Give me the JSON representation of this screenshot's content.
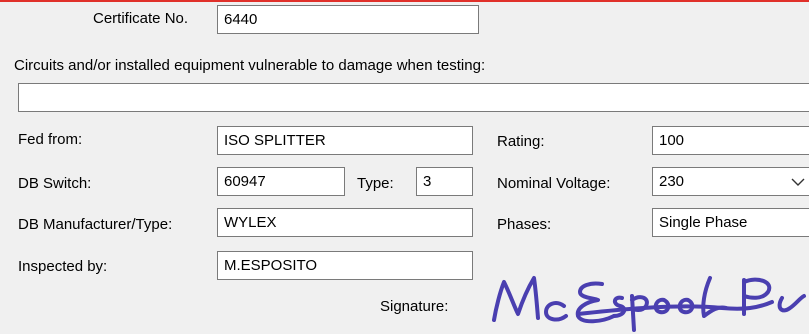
{
  "certificate": {
    "label": "Certificate No.",
    "value": "6440"
  },
  "vulnerable": {
    "label": "Circuits and/or installed equipment vulnerable to damage when testing:",
    "value": ""
  },
  "fed_from": {
    "label": "Fed from:",
    "value": "ISO SPLITTER"
  },
  "db_switch": {
    "label": "DB Switch:",
    "value": "60947"
  },
  "type": {
    "label": "Type:",
    "value": "3"
  },
  "db_manufacturer": {
    "label": "DB Manufacturer/Type:",
    "value": "WYLEX"
  },
  "inspected_by": {
    "label": "Inspected by:",
    "value": "M.ESPOSITO"
  },
  "rating": {
    "label": "Rating:",
    "value": "100"
  },
  "nominal_voltage": {
    "label": "Nominal Voltage:",
    "value": "230",
    "icon": "chevron-down-icon"
  },
  "phases": {
    "label": "Phases:",
    "value": "Single Phase"
  },
  "signature": {
    "label": "Signature:",
    "ink_color": "#4a3fb0",
    "image_text": "M.Esposito"
  },
  "colors": {
    "top_border": "#e0302a",
    "background": "#f0f0f0",
    "field_border": "#7a7a7a"
  }
}
